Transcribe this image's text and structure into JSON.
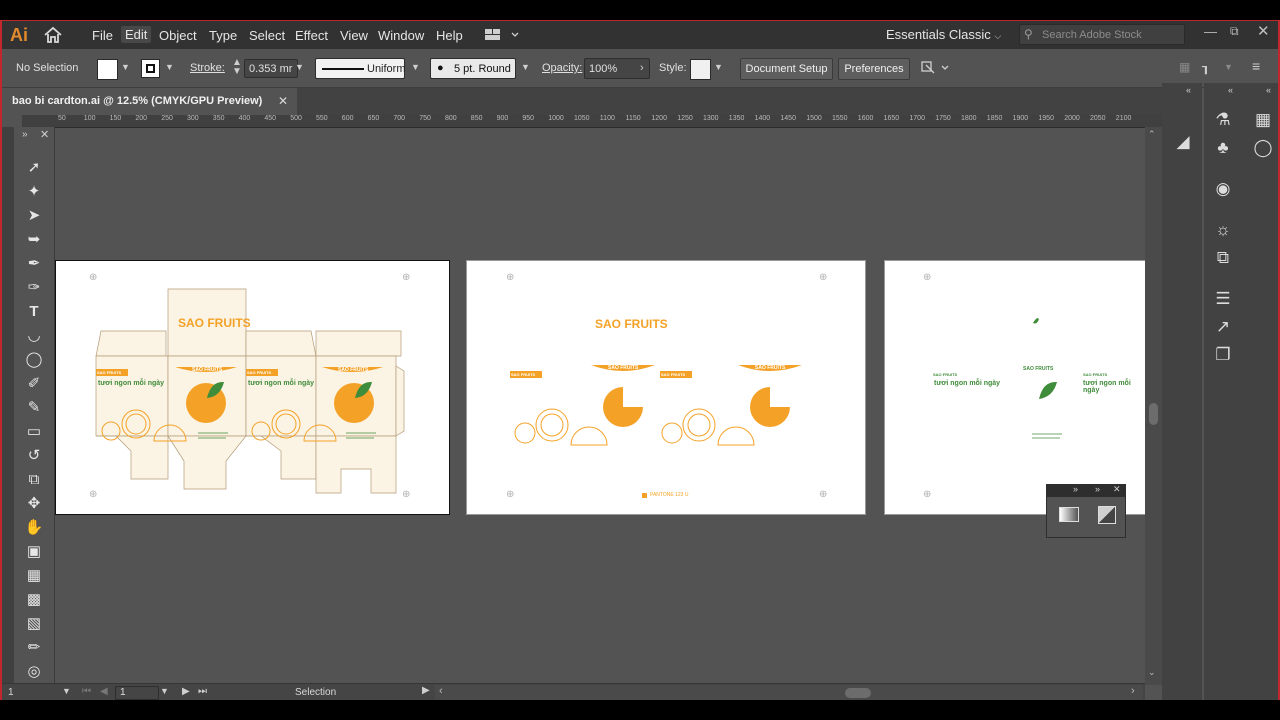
{
  "app": {
    "logo": "Ai",
    "workspace": "Essentials Classic",
    "stock_placeholder": "Search Adobe Stock"
  },
  "menu": [
    "File",
    "Edit",
    "Object",
    "Type",
    "Select",
    "Effect",
    "View",
    "Window",
    "Help"
  ],
  "control": {
    "selection": "No Selection",
    "stroke_label": "Stroke:",
    "stroke_value": "0.353 mr",
    "profile": "Uniform",
    "brush": "5 pt. Round",
    "opacity_label": "Opacity:",
    "opacity_value": "100%",
    "style_label": "Style:",
    "doc_setup": "Document Setup",
    "preferences": "Preferences"
  },
  "tab": {
    "title": "bao bi cardton.ai @ 12.5% (CMYK/GPU Preview)"
  },
  "ruler": [
    "50",
    "100",
    "150",
    "200",
    "250",
    "300",
    "350",
    "400",
    "450",
    "500",
    "550",
    "600",
    "650",
    "700",
    "750",
    "800",
    "850",
    "900",
    "950",
    "1000",
    "1050",
    "1100",
    "1150",
    "1200",
    "1250",
    "1300",
    "1350",
    "1400",
    "1450",
    "1500",
    "1550",
    "1600",
    "1650",
    "1700",
    "1750",
    "1800",
    "1850",
    "1900",
    "1950",
    "2000",
    "2050",
    "2100"
  ],
  "artwork": {
    "brand": "SAO FRUITS",
    "slogan": "tươi ngon mỗi ngày",
    "pantone": "PANTONE 123 U"
  },
  "status": {
    "page": "1",
    "mode": "Selection",
    "panel_number": "1"
  },
  "colors": {
    "brand_orange": "#f4a227",
    "brand_green": "#3f8c3a",
    "frame_red": "#c1272d"
  }
}
